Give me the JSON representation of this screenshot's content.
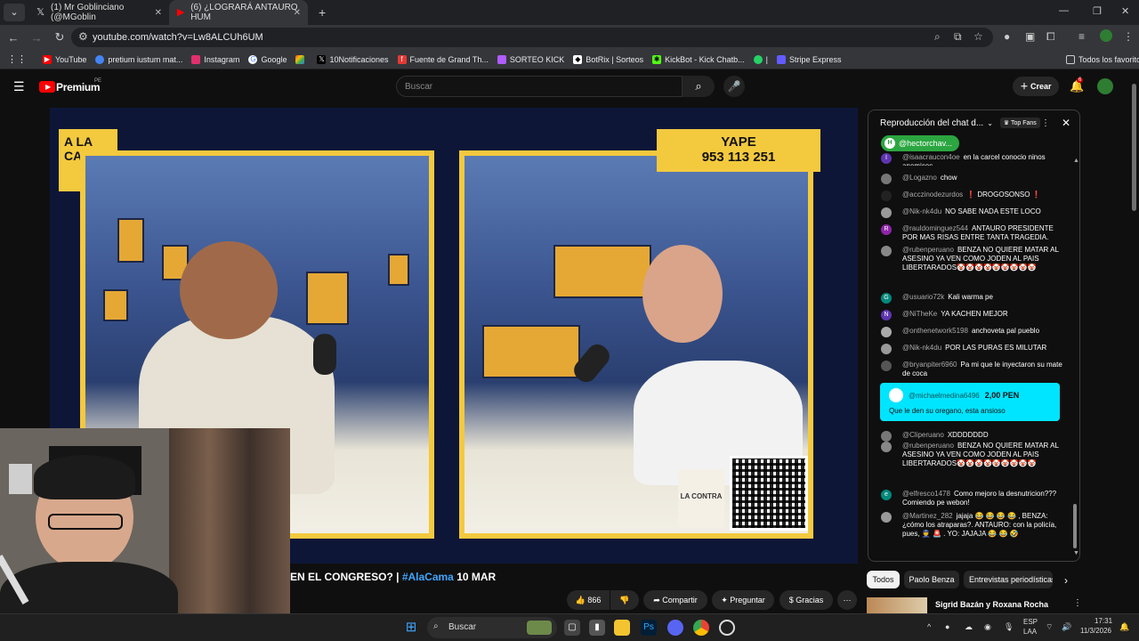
{
  "browser": {
    "tabs": [
      {
        "title": "(1) Mr Goblinciano (@MGoblin",
        "icon": "x-logo-icon"
      },
      {
        "title": "(6) ¿LOGRARÁ ANTAURO HUM",
        "icon": "youtube-icon"
      }
    ],
    "new_tab": "+",
    "url": "youtube.com/watch?v=Lw8ALCUh6UM"
  },
  "bookmarks": [
    {
      "label": "YouTube",
      "color": "#ff0000"
    },
    {
      "label": "pretium iustum mat...",
      "color": "#4285f4"
    },
    {
      "label": "Instagram",
      "color": "#e1306c"
    },
    {
      "label": "Google",
      "color": "#4285f4"
    },
    {
      "label": "",
      "color": "#3ea6ff"
    },
    {
      "label": "10Notificaciones",
      "color": "#000000"
    },
    {
      "label": "Fuente de Grand Th...",
      "color": "#e53935"
    },
    {
      "label": "SORTEO KICK",
      "color": "#b05cff"
    },
    {
      "label": "BotRix | Sorteos",
      "color": "#ffffff"
    },
    {
      "label": "KickBot - Kick Chatb...",
      "color": "#53fc18"
    },
    {
      "label": "|",
      "color": "#25d366"
    },
    {
      "label": "Stripe Express",
      "color": "#635bff"
    }
  ],
  "bookmarks_all": "Todos los favoritos",
  "youtube": {
    "brand": "Premium",
    "region": "PE",
    "search_placeholder": "Buscar",
    "create_label": "Crear",
    "notif_count": "6"
  },
  "video": {
    "logo_line1": "A LA",
    "logo_line2": "CAMA",
    "yape_label": "YAPE",
    "yape_number": "953 113 251",
    "mug_text": "LA CONTRA",
    "title_prefix": "EN EL CONGRESO? | ",
    "title_hashtag": "#AlaCama",
    "title_suffix": " 10 MAR",
    "likes": "866",
    "share": "Compartir",
    "ask": "Preguntar",
    "thanks": "Gracias"
  },
  "chat": {
    "title": "Reproducción del chat d...",
    "top_fans": "Top Fans",
    "pinned": "@hectorchav...",
    "messages": [
      {
        "author": "@isaacraucon4oe",
        "text": "en la carcel conocio ninos anemicos",
        "avatar": "I",
        "color": "#5e35b1"
      },
      {
        "author": "@Logazno",
        "text": "chow",
        "avatar": "",
        "color": "#777"
      },
      {
        "author": "@acczinodezurdos",
        "text": "❗ DROGOSONSO ❗",
        "avatar": "",
        "color": "#222"
      },
      {
        "author": "@Nik-nk4du",
        "text": "NO SABE NADA ESTE LOCO",
        "avatar": "",
        "color": "#999"
      },
      {
        "author": "@rauldominguez544",
        "text": "ANTAURO PRESIDENTE POR MAS RISAS ENTRE TANTA TRAGEDIA.",
        "avatar": "R",
        "color": "#8e24aa"
      },
      {
        "author": "@rubenperuano",
        "text": "BENZA NO QUIERE MATAR AL ASESINO YA VEN COMO JODEN AL PAIS LIBERTARADOS🤡🤡🤡🤡🤡🤡🤡🤡🤡",
        "avatar": "",
        "color": "#888"
      },
      {
        "author": "@usuario72k",
        "text": "Kali warma pe",
        "avatar": "G",
        "color": "#00897b"
      },
      {
        "author": "@NiTheKe",
        "text": "YA KACHEN MEJOR",
        "avatar": "N",
        "color": "#5e35b1"
      },
      {
        "author": "@onthenetwork5198",
        "text": "anchoveta pal pueblo",
        "avatar": "",
        "color": "#aaa"
      },
      {
        "author": "@Nik-nk4du",
        "text": "POR LAS PURAS ES MILUTAR",
        "avatar": "",
        "color": "#999"
      },
      {
        "author": "@bryanpiter6960",
        "text": "Pa mi que le inyectaron su mate de coca",
        "avatar": "",
        "color": "#555"
      },
      {
        "author": "@Cliperuano",
        "text": "XDDDDDDD",
        "avatar": "",
        "color": "#777"
      },
      {
        "author": "@rubenperuano",
        "text": "BENZA NO QUIERE MATAR AL ASESINO YA VEN COMO JODEN AL PAIS LIBERTARADOS🤡🤡🤡🤡🤡🤡🤡🤡🤡",
        "avatar": "",
        "color": "#888"
      },
      {
        "author": "@elfresco1478",
        "text": "Como mejoro la desnutricion??? Comiendo pe webon!",
        "avatar": "e",
        "color": "#00897b"
      },
      {
        "author": "@Martinez_282",
        "text": "jajaja 😂 😂 😂 😂 , BENZA: ¿cómo los atraparas?. ANTAURO: con la policía, pues, 👮 🚨 . YO: JAJAJA 😂 😂 🤣",
        "avatar": "",
        "color": "#999"
      }
    ],
    "superchat": {
      "author": "@michaelmedina6496",
      "amount": "2,00 PEN",
      "text": "Que le den su oregano, esta ansioso"
    }
  },
  "chips": [
    "Todos",
    "Paolo Benza",
    "Entrevistas periodísticas"
  ],
  "recommended": {
    "title": "Sigrid Bazán y Roxana Rocha"
  },
  "taskbar": {
    "search": "Buscar",
    "lang": "ESP",
    "lang2": "LAA",
    "time": "17:31",
    "date": "11/3/2026"
  }
}
